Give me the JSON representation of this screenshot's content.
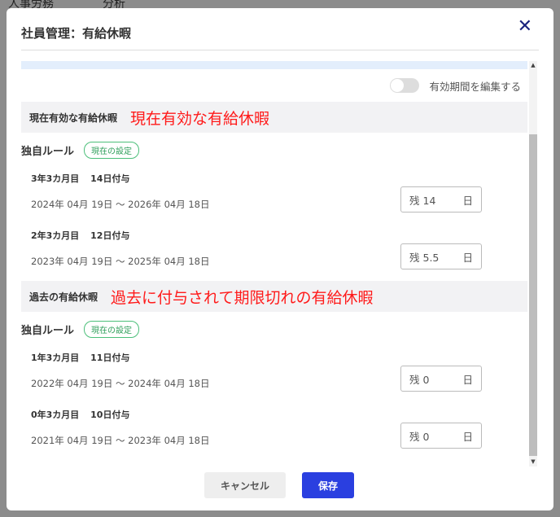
{
  "background": {
    "nav": [
      "人事労務",
      "分析"
    ]
  },
  "modal": {
    "title": "社員管理：有給休暇",
    "toggle_label": "有効期間を編集する",
    "toggle_on": false,
    "sections": [
      {
        "label": "現在有効な有給休暇",
        "annotation": "現在有効な有給休暇",
        "rule": "独自ルール",
        "badge": "現在の設定",
        "items": [
          {
            "tenure": "3年3カ月目",
            "granted": "14日付与",
            "period": "2024年 04月 19日 〜 2026年 04月 18日",
            "remain_prefix": "残",
            "remain": "14",
            "unit": "日"
          },
          {
            "tenure": "2年3カ月目",
            "granted": "12日付与",
            "period": "2023年 04月 19日 〜 2025年 04月 18日",
            "remain_prefix": "残",
            "remain": "5.5",
            "unit": "日"
          }
        ]
      },
      {
        "label": "過去の有給休暇",
        "annotation": "過去に付与されて期限切れの有給休暇",
        "rule": "独自ルール",
        "badge": "現在の設定",
        "items": [
          {
            "tenure": "1年3カ月目",
            "granted": "11日付与",
            "period": "2022年 04月 19日 〜 2024年 04月 18日",
            "remain_prefix": "残",
            "remain": "0",
            "unit": "日"
          },
          {
            "tenure": "0年3カ月目",
            "granted": "10日付与",
            "period": "2021年 04月 19日 〜 2023年 04月 18日",
            "remain_prefix": "残",
            "remain": "0",
            "unit": "日"
          }
        ]
      }
    ],
    "cancel": "キャンセル",
    "save": "保存"
  }
}
